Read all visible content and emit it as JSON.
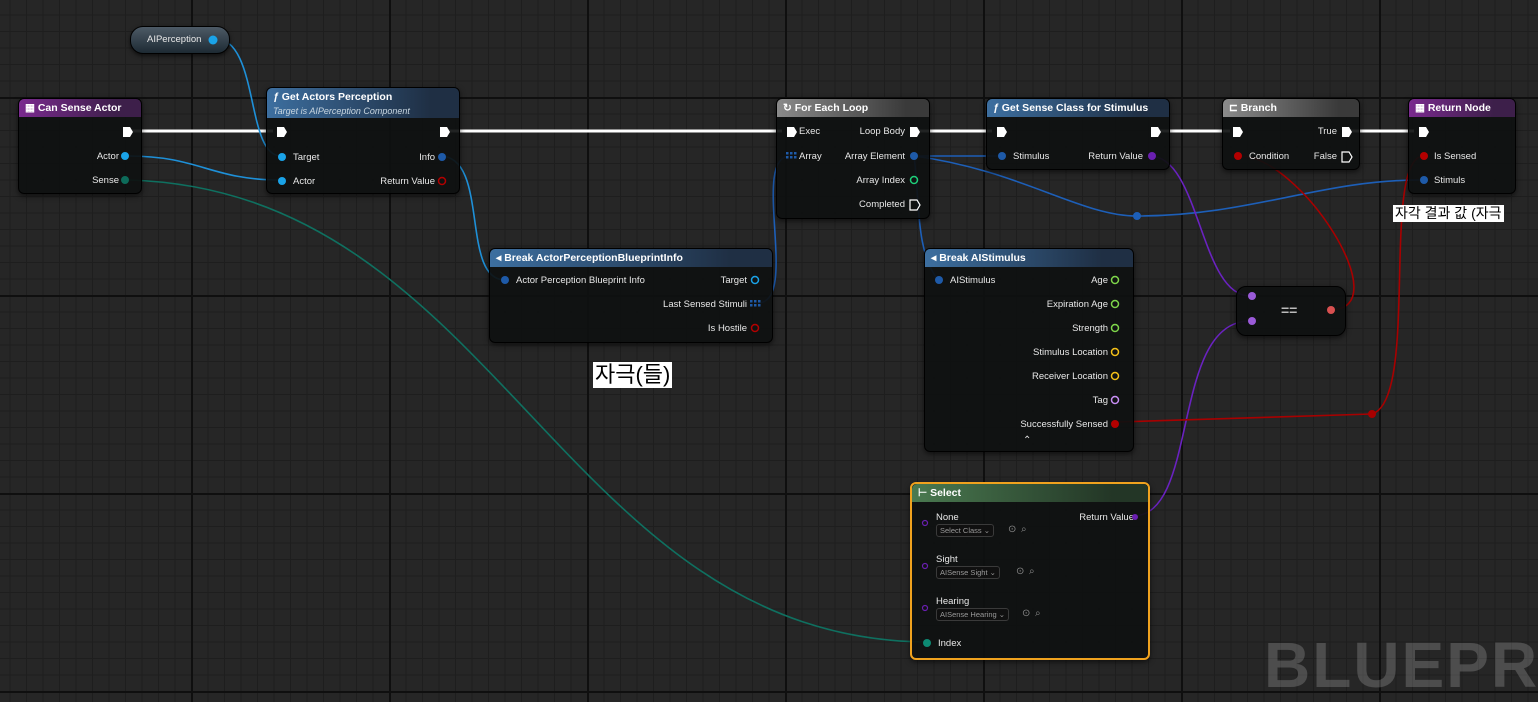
{
  "variable_node": {
    "label": "AIPerception"
  },
  "can_sense_actor": {
    "title": "Can Sense Actor",
    "pins": {
      "actor": "Actor",
      "sense": "Sense"
    }
  },
  "get_actors_perception": {
    "title": "Get Actors Perception",
    "subtitle": "Target is AIPerception Component",
    "pins": {
      "target": "Target",
      "actor": "Actor",
      "info": "Info",
      "return_value": "Return Value"
    }
  },
  "break_actor_perception": {
    "title": "Break ActorPerceptionBlueprintInfo",
    "pins": {
      "input": "Actor Perception Blueprint Info",
      "target": "Target",
      "last_sensed": "Last Sensed Stimuli",
      "is_hostile": "Is Hostile"
    }
  },
  "for_each_loop": {
    "title": "For Each Loop",
    "pins": {
      "exec": "Exec",
      "array": "Array",
      "loop_body": "Loop Body",
      "array_element": "Array Element",
      "array_index": "Array Index",
      "completed": "Completed"
    }
  },
  "get_sense_class": {
    "title": "Get Sense Class for Stimulus",
    "pins": {
      "stimulus": "Stimulus",
      "return_value": "Return Value"
    }
  },
  "break_aistimulus": {
    "title": "Break AIStimulus",
    "pins": {
      "input": "AIStimulus",
      "age": "Age",
      "expiration_age": "Expiration Age",
      "strength": "Strength",
      "stimulus_location": "Stimulus Location",
      "receiver_location": "Receiver Location",
      "tag": "Tag",
      "successfully_sensed": "Successfully Sensed"
    }
  },
  "branch": {
    "title": "Branch",
    "pins": {
      "condition": "Condition",
      "true": "True",
      "false": "False"
    }
  },
  "return_node": {
    "title": "Return Node",
    "pins": {
      "is_sensed": "Is Sensed",
      "stimuls": "Stimuls"
    }
  },
  "equals_node": {
    "label": "=="
  },
  "select_node": {
    "title": "Select",
    "options": [
      {
        "label": "None",
        "value": "Select Class"
      },
      {
        "label": "Sight",
        "value": "AISense Sight"
      },
      {
        "label": "Hearing",
        "value": "AISense Hearing"
      }
    ],
    "return_value": "Return Value",
    "index": "Index"
  },
  "captions": {
    "stimuli": "자극(들)",
    "result": "자각 결과 값 (자극"
  },
  "watermark": "BLUEPRINT",
  "colors": {
    "exec": "#ffffff",
    "object": "#1aa3e8",
    "bool": "#b30000",
    "class": "#6a1fb0",
    "byte": "#0d6b5a",
    "struct": "#1e5aa8"
  }
}
